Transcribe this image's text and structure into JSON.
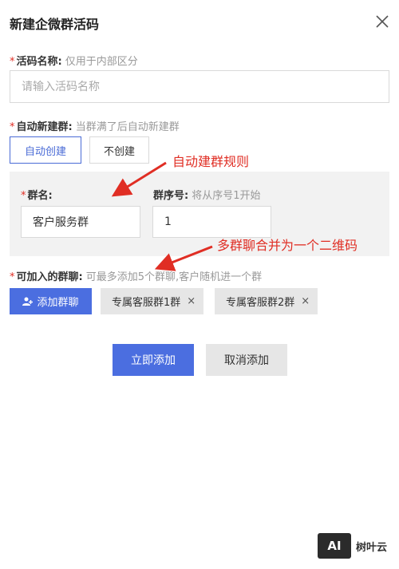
{
  "dialog": {
    "title": "新建企微群活码",
    "close_icon": "close-icon"
  },
  "code_name": {
    "required_mark": "*",
    "label": "活码名称:",
    "hint": "仅用于内部区分",
    "placeholder": "请输入活码名称",
    "value": ""
  },
  "auto_create": {
    "required_mark": "*",
    "label": "自动新建群:",
    "hint": "当群满了后自动新建群",
    "options": [
      "自动创建",
      "不创建"
    ],
    "selected": "自动创建"
  },
  "group_rule": {
    "name_required_mark": "*",
    "name_label": "群名:",
    "name_value": "客户服务群",
    "seq_label": "群序号:",
    "seq_hint": "将从序号1开始",
    "seq_value": "1"
  },
  "joinable_groups": {
    "required_mark": "*",
    "label": "可加入的群聊:",
    "hint": "可最多添加5个群聊,客户随机进一个群",
    "add_button": "添加群聊",
    "add_icon": "add-user-icon",
    "tags": [
      {
        "label": "专属客服群1群",
        "remove": "×"
      },
      {
        "label": "专属客服群2群",
        "remove": "×"
      }
    ]
  },
  "actions": {
    "confirm": "立即添加",
    "cancel": "取消添加"
  },
  "annotations": {
    "rule_note": "自动建群规则",
    "merge_note": "多群聊合并为一个二维码",
    "color": "#e02e24"
  },
  "watermark": {
    "logo_mark": "AI",
    "logo_text": "树叶云"
  },
  "colors": {
    "primary": "#4b6ee0",
    "required": "#e02e24"
  }
}
